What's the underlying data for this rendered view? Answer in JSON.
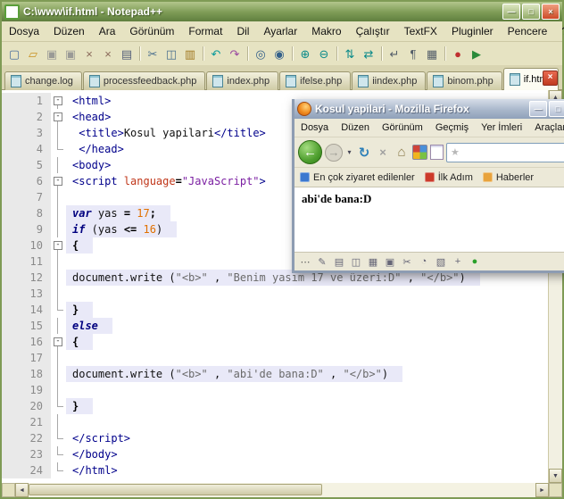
{
  "scrollbar": {
    "up": "▲",
    "down": "▼",
    "left": "◄",
    "right": "►"
  },
  "notepad": {
    "window_title": "C:\\www\\if.html - Notepad++",
    "tab_close_glyph": "×",
    "window_buttons": [
      {
        "name": "minimize-button",
        "glyph": "—",
        "cls": "wmin"
      },
      {
        "name": "maximize-button",
        "glyph": "□",
        "cls": "wmax"
      },
      {
        "name": "close-button",
        "glyph": "×",
        "cls": "wclose"
      }
    ],
    "menu_items": [
      "Dosya",
      "Düzen",
      "Ara",
      "Görünüm",
      "Format",
      "Dil",
      "Ayarlar",
      "Makro",
      "Çalıştır",
      "TextFX",
      "Pluginler",
      "Pencere",
      "?"
    ],
    "toolbar": [
      {
        "name": "new-file-icon",
        "glyph": "▢",
        "color": "#4a6f9e"
      },
      {
        "name": "open-folder-icon",
        "glyph": "▱",
        "color": "#c89020"
      },
      {
        "name": "save-icon",
        "glyph": "▣",
        "color": "#9a9a96"
      },
      {
        "name": "save-all-icon",
        "glyph": "▣",
        "color": "#9a9a96"
      },
      {
        "name": "close-file-icon",
        "glyph": "×",
        "color": "#8a6a5a"
      },
      {
        "name": "close-all-icon",
        "glyph": "×",
        "color": "#8a6a5a"
      },
      {
        "name": "print-icon",
        "glyph": "▤",
        "color": "#55607a"
      },
      {
        "sep": true
      },
      {
        "name": "cut-icon",
        "glyph": "✂",
        "color": "#4a6f8e"
      },
      {
        "name": "copy-icon",
        "glyph": "◫",
        "color": "#4a6f8e"
      },
      {
        "name": "paste-icon",
        "glyph": "▥",
        "color": "#a07820"
      },
      {
        "sep": true
      },
      {
        "name": "undo-icon",
        "glyph": "↶",
        "color": "#0a9a9a"
      },
      {
        "name": "redo-icon",
        "glyph": "↷",
        "color": "#9a4aa0"
      },
      {
        "sep": true
      },
      {
        "name": "find-icon",
        "glyph": "◎",
        "color": "#33608a"
      },
      {
        "name": "replace-icon",
        "glyph": "◉",
        "color": "#33608a"
      },
      {
        "sep": true
      },
      {
        "name": "zoom-in-icon",
        "glyph": "⊕",
        "color": "#0a8a8a"
      },
      {
        "name": "zoom-out-icon",
        "glyph": "⊖",
        "color": "#0a8a8a"
      },
      {
        "sep": true
      },
      {
        "name": "sync-vertical-icon",
        "glyph": "⇅",
        "color": "#0a8a8a"
      },
      {
        "name": "sync-horizontal-icon",
        "glyph": "⇄",
        "color": "#0a8a8a"
      },
      {
        "sep": true
      },
      {
        "name": "word-wrap-icon",
        "glyph": "↵",
        "color": "#555f6a"
      },
      {
        "name": "show-all-chars-icon",
        "glyph": "¶",
        "color": "#555f6a"
      },
      {
        "name": "indent-guide-icon",
        "glyph": "▦",
        "color": "#555f6a"
      },
      {
        "sep": true
      },
      {
        "name": "macro-record-icon",
        "glyph": "●",
        "color": "#c03030"
      },
      {
        "name": "macro-play-icon",
        "glyph": "▶",
        "color": "#2a8a3a"
      }
    ],
    "tabs": [
      {
        "label": "change.log",
        "active": false
      },
      {
        "label": "processfeedback.php",
        "active": false
      },
      {
        "label": "index.php",
        "active": false
      },
      {
        "label": "ifelse.php",
        "active": false
      },
      {
        "label": "iindex.php",
        "active": false
      },
      {
        "label": "binom.php",
        "active": false
      },
      {
        "label": "if.html",
        "active": true
      }
    ],
    "editor": {
      "lines": [
        {
          "n": 1,
          "fold": "box",
          "js": false,
          "tokens": [
            [
              "tag",
              "<html>"
            ]
          ]
        },
        {
          "n": 2,
          "fold": "box",
          "js": false,
          "tokens": [
            [
              "tag",
              "<head>"
            ]
          ]
        },
        {
          "n": 3,
          "fold": "line",
          "js": false,
          "tokens": [
            [
              "pln",
              " "
            ],
            [
              "tag",
              "<title>"
            ],
            [
              "pln",
              "Kosul yapilari"
            ],
            [
              "tag",
              "</title>"
            ]
          ]
        },
        {
          "n": 4,
          "fold": "end",
          "js": false,
          "tokens": [
            [
              "pln",
              " "
            ],
            [
              "tag",
              "</head>"
            ]
          ]
        },
        {
          "n": 5,
          "fold": "line",
          "js": false,
          "tokens": [
            [
              "tag",
              "<body>"
            ]
          ]
        },
        {
          "n": 6,
          "fold": "box",
          "js": false,
          "tokens": [
            [
              "tag",
              "<script "
            ],
            [
              "attr",
              "language"
            ],
            [
              "op",
              "="
            ],
            [
              "val",
              "\"JavaScript\""
            ],
            [
              "tag",
              ">"
            ]
          ]
        },
        {
          "n": 7,
          "fold": "line",
          "js": true,
          "tokens": []
        },
        {
          "n": 8,
          "fold": "line",
          "js": true,
          "tokens": [
            [
              "kw",
              "var"
            ],
            [
              "pln",
              " yas "
            ],
            [
              "op",
              "="
            ],
            [
              "pln",
              " "
            ],
            [
              "num",
              "17"
            ],
            [
              "op",
              ";"
            ]
          ]
        },
        {
          "n": 9,
          "fold": "line",
          "js": true,
          "tokens": [
            [
              "kw",
              "if"
            ],
            [
              "pln",
              " (yas "
            ],
            [
              "op",
              "<="
            ],
            [
              "pln",
              " "
            ],
            [
              "num",
              "16"
            ],
            [
              "pln",
              ")"
            ]
          ]
        },
        {
          "n": 10,
          "fold": "box",
          "js": true,
          "tokens": [
            [
              "op",
              "{"
            ]
          ]
        },
        {
          "n": 11,
          "fold": "line",
          "js": true,
          "tokens": []
        },
        {
          "n": 12,
          "fold": "line",
          "js": true,
          "tokens": [
            [
              "pln",
              "document.write ("
            ],
            [
              "str",
              "\"<b>\""
            ],
            [
              "pln",
              " , "
            ],
            [
              "str",
              "\"Benim yasım 17 ve üzeri:D\""
            ],
            [
              "pln",
              " , "
            ],
            [
              "str",
              "\"</b>\""
            ],
            [
              "pln",
              ")"
            ]
          ]
        },
        {
          "n": 13,
          "fold": "line",
          "js": true,
          "tokens": []
        },
        {
          "n": 14,
          "fold": "end",
          "js": true,
          "tokens": [
            [
              "op",
              "}"
            ]
          ]
        },
        {
          "n": 15,
          "fold": "line",
          "js": true,
          "tokens": [
            [
              "kw",
              "else"
            ]
          ]
        },
        {
          "n": 16,
          "fold": "box",
          "js": true,
          "tokens": [
            [
              "op",
              "{"
            ]
          ]
        },
        {
          "n": 17,
          "fold": "line",
          "js": true,
          "tokens": []
        },
        {
          "n": 18,
          "fold": "line",
          "js": true,
          "tokens": [
            [
              "pln",
              "document.write ("
            ],
            [
              "str",
              "\"<b>\""
            ],
            [
              "pln",
              " , "
            ],
            [
              "str",
              "\"abi'de bana:D\""
            ],
            [
              "pln",
              " , "
            ],
            [
              "str",
              "\"</b>\""
            ],
            [
              "pln",
              ")"
            ]
          ]
        },
        {
          "n": 19,
          "fold": "line",
          "js": true,
          "tokens": []
        },
        {
          "n": 20,
          "fold": "end",
          "js": true,
          "tokens": [
            [
              "op",
              "}"
            ]
          ]
        },
        {
          "n": 21,
          "fold": "line",
          "js": true,
          "tokens": []
        },
        {
          "n": 22,
          "fold": "end",
          "js": false,
          "tokens": [
            [
              "tag",
              "</script>"
            ]
          ]
        },
        {
          "n": 23,
          "fold": "end",
          "js": false,
          "tokens": [
            [
              "tag",
              "</body>"
            ]
          ]
        },
        {
          "n": 24,
          "fold": "end",
          "js": false,
          "tokens": [
            [
              "tag",
              "</html>"
            ]
          ]
        }
      ]
    }
  },
  "firefox": {
    "window_title": "Kosul yapilari - Mozilla Firefox",
    "window_buttons": [
      {
        "name": "minimize-button",
        "glyph": "—",
        "cls": "wmin"
      },
      {
        "name": "maximize-button",
        "glyph": "□",
        "cls": "wmax"
      },
      {
        "name": "close-button",
        "glyph": "×",
        "cls": "wclose"
      }
    ],
    "menu_items": [
      "Dosya",
      "Düzen",
      "Görünüm",
      "Geçmiş",
      "Yer İmleri",
      "Araçlar"
    ],
    "nav": [
      {
        "name": "back-button",
        "cls": "back",
        "glyph": "←"
      },
      {
        "name": "forward-button",
        "cls": "fwd",
        "glyph": "→"
      },
      {
        "name": "back-history-dropdown",
        "cls": "drop",
        "glyph": "▾"
      },
      {
        "name": "reload-button",
        "cls": "reload",
        "glyph": "↻"
      },
      {
        "name": "stop-button",
        "cls": "stop",
        "glyph": "×"
      },
      {
        "name": "home-button",
        "cls": "home",
        "glyph": "⌂"
      },
      {
        "name": "speed-dial-icon",
        "cls": "quad",
        "glyph": ""
      },
      {
        "name": "new-page-icon",
        "cls": "page",
        "glyph": ""
      },
      {
        "name": "location-bar",
        "cls": "locbar",
        "glyph": "★"
      }
    ],
    "bookmarks": [
      {
        "icon": "most-visited-icon",
        "label": "En çok ziyaret edilenler",
        "color": "#3b78cf"
      },
      {
        "icon": "ilk-adim-icon",
        "label": "İlk Adım",
        "color": "#cc3a2a"
      },
      {
        "icon": "haberler-icon",
        "label": "Haberler",
        "color": "#e8a33d"
      }
    ],
    "content_text": "abi'de bana:D",
    "statusbar_icons": [
      {
        "name": "overflow-menu-icon",
        "glyph": "⋯",
        "color": "#555"
      },
      {
        "name": "addon-icon-1",
        "glyph": "✎",
        "color": "#667"
      },
      {
        "name": "addon-icon-2",
        "glyph": "▤",
        "color": "#667"
      },
      {
        "name": "addon-icon-3",
        "glyph": "◫",
        "color": "#667"
      },
      {
        "name": "addon-icon-4",
        "glyph": "▦",
        "color": "#667"
      },
      {
        "name": "addon-icon-5",
        "glyph": "▣",
        "color": "#667"
      },
      {
        "name": "addon-icon-6",
        "glyph": "✂",
        "color": "#667"
      },
      {
        "name": "addon-icon-7",
        "glyph": "◔",
        "color": "#667"
      },
      {
        "name": "addon-icon-8",
        "glyph": "▧",
        "color": "#667"
      },
      {
        "name": "addon-icon-9",
        "glyph": "+",
        "color": "#667"
      },
      {
        "name": "addon-status-icon",
        "glyph": "●",
        "color": "#2aa02a"
      }
    ]
  }
}
